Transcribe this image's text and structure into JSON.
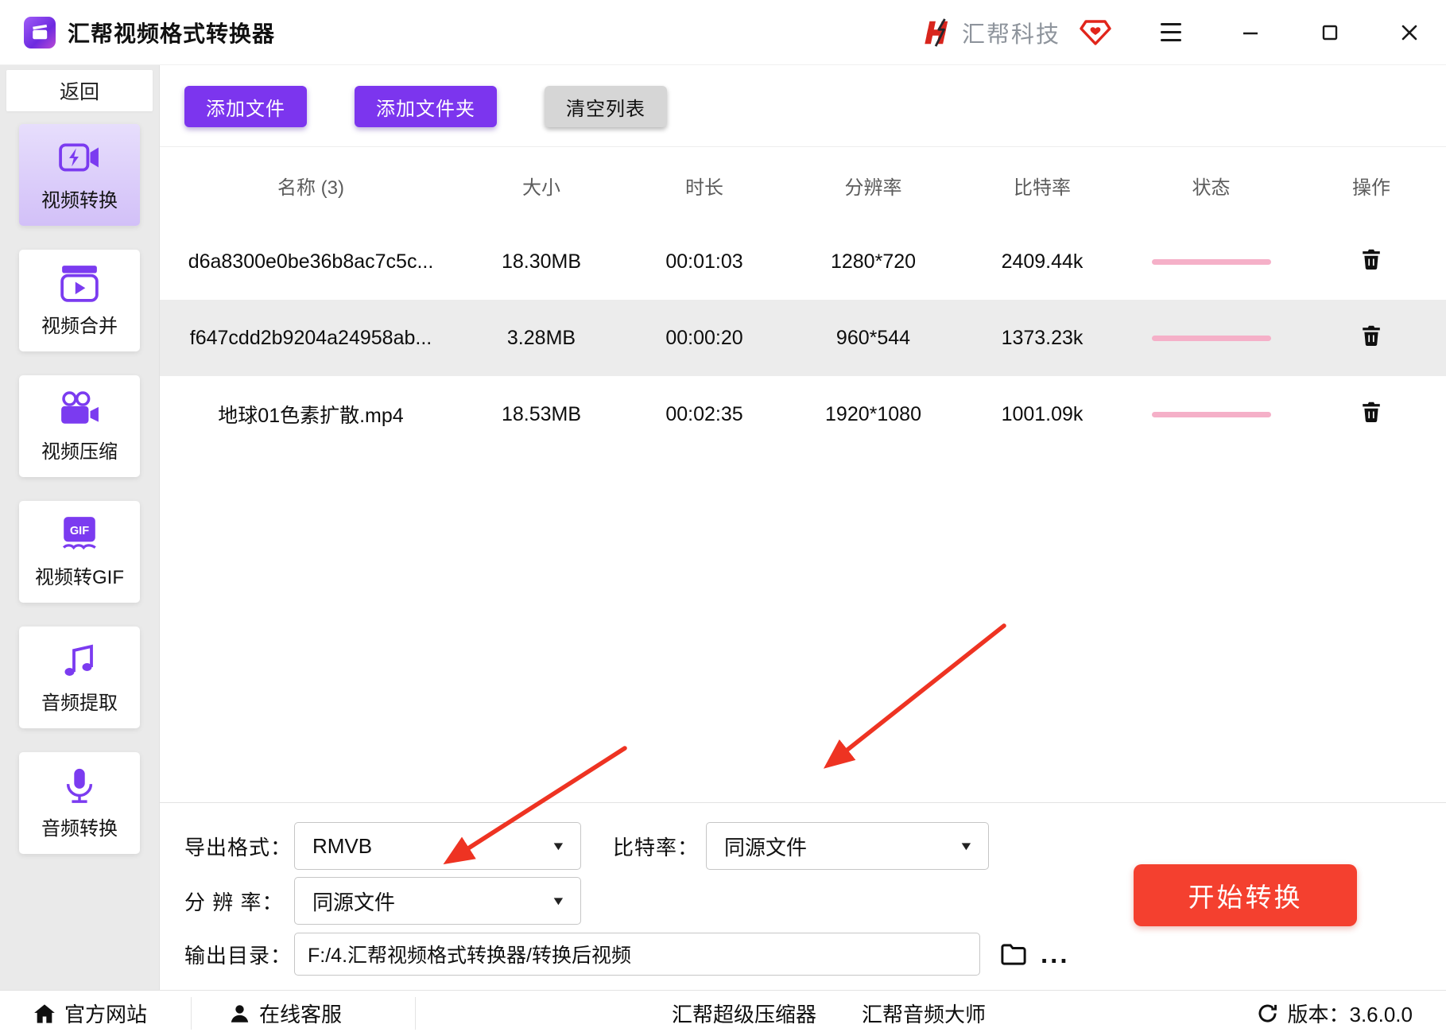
{
  "titlebar": {
    "app_title": "汇帮视频格式转换器",
    "brand_name": "汇帮科技"
  },
  "sidebar": {
    "back_label": "返回",
    "items": [
      {
        "label": "视频转换",
        "active": true
      },
      {
        "label": "视频合并",
        "active": false
      },
      {
        "label": "视频压缩",
        "active": false
      },
      {
        "label": "视频转GIF",
        "active": false
      },
      {
        "label": "音频提取",
        "active": false
      },
      {
        "label": "音频转换",
        "active": false
      }
    ]
  },
  "toolbar": {
    "add_file_label": "添加文件",
    "add_folder_label": "添加文件夹",
    "clear_list_label": "清空列表"
  },
  "table": {
    "headers": {
      "name": "名称 (3)",
      "size": "大小",
      "duration": "时长",
      "resolution": "分辨率",
      "bitrate": "比特率",
      "status": "状态",
      "action": "操作"
    },
    "rows": [
      {
        "name": "d6a8300e0be36b8ac7c5c...",
        "size": "18.30MB",
        "duration": "00:01:03",
        "resolution": "1280*720",
        "bitrate": "2409.44k"
      },
      {
        "name": "f647cdd2b9204a24958ab...",
        "size": "3.28MB",
        "duration": "00:00:20",
        "resolution": "960*544",
        "bitrate": "1373.23k"
      },
      {
        "name": "地球01色素扩散.mp4",
        "size": "18.53MB",
        "duration": "00:02:35",
        "resolution": "1920*1080",
        "bitrate": "1001.09k"
      }
    ]
  },
  "settings": {
    "export_format_label": "导出格式：",
    "export_format_value": "RMVB",
    "bitrate_label": "比特率：",
    "bitrate_value": "同源文件",
    "resolution_label": "分 辨 率：",
    "resolution_value": "同源文件",
    "output_dir_label": "输出目录：",
    "output_dir_value": "F:/4.汇帮视频格式转换器/转换后视频",
    "start_button_label": "开始转换"
  },
  "statusbar": {
    "official_site": "官方网站",
    "online_service": "在线客服",
    "super_compressor": "汇帮超级压缩器",
    "audio_master": "汇帮音频大师",
    "version": "版本：3.6.0.0"
  },
  "icons": {
    "chevron_down": "▼",
    "more_dots": "..."
  },
  "colors": {
    "accent_purple": "#7b3bf0",
    "start_red": "#f4402f",
    "progress_pink": "#f5b0c8",
    "arrow_red": "#ee3322",
    "brand_red": "#d8251d"
  }
}
